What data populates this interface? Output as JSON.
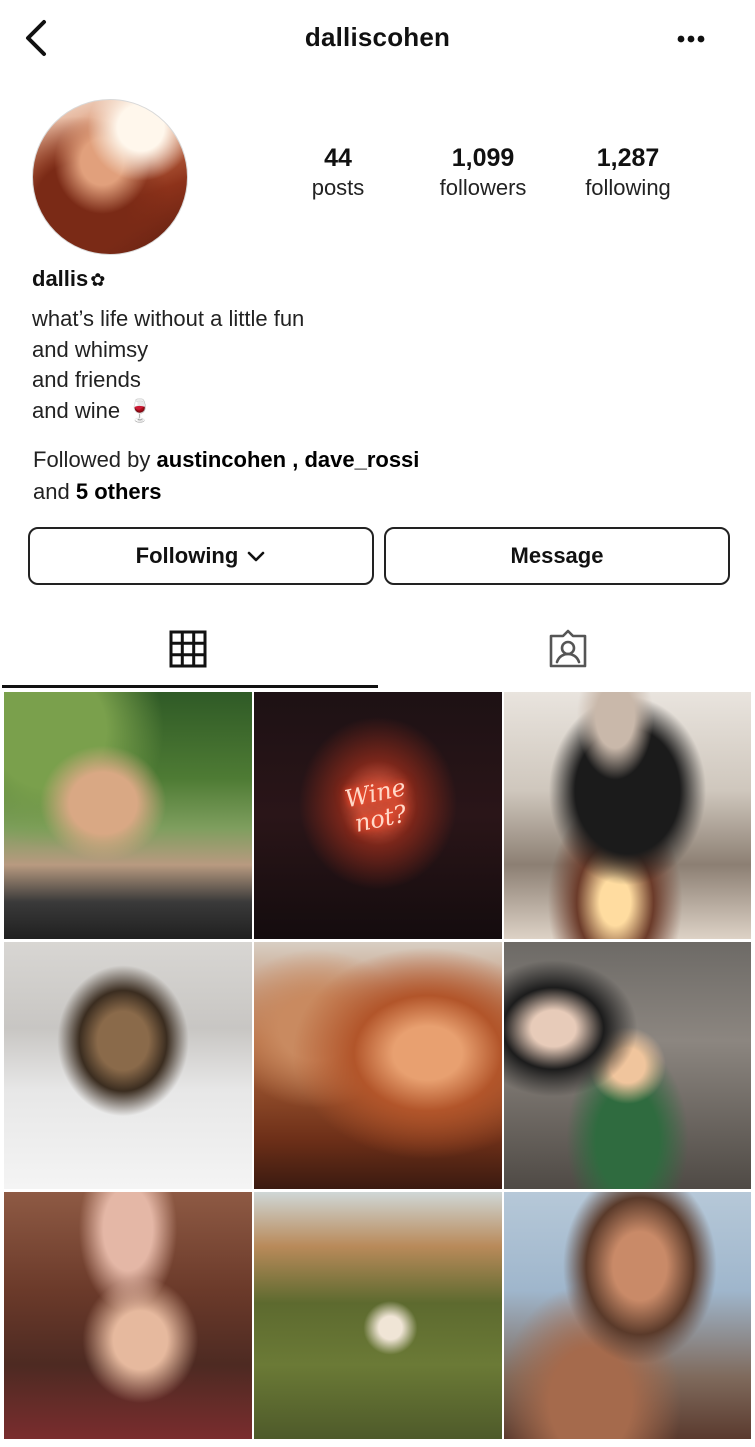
{
  "header": {
    "username": "dalliscohen"
  },
  "profile": {
    "stats": {
      "posts_count": "44",
      "posts_label": "posts",
      "followers_count": "1,099",
      "followers_label": "followers",
      "following_count": "1,287",
      "following_label": "following"
    },
    "display_name": "dallis",
    "name_emoji": "✿",
    "bio_lines": [
      "what’s life without a little fun",
      "and whimsy",
      "and friends",
      "and wine 🍷"
    ],
    "followed_by": {
      "prefix": "Followed by",
      "user1": "austincohen",
      "separator": " , ",
      "user2": "dave_rossi",
      "and_text": "and",
      "others": "5 others"
    }
  },
  "actions": {
    "following_label": "Following",
    "message_label": "Message"
  },
  "tabs": {
    "grid_icon": "grid-icon",
    "tagged_icon": "tagged-icon"
  },
  "posts": {
    "neon_line1": "Wine",
    "neon_line2": "not?"
  }
}
